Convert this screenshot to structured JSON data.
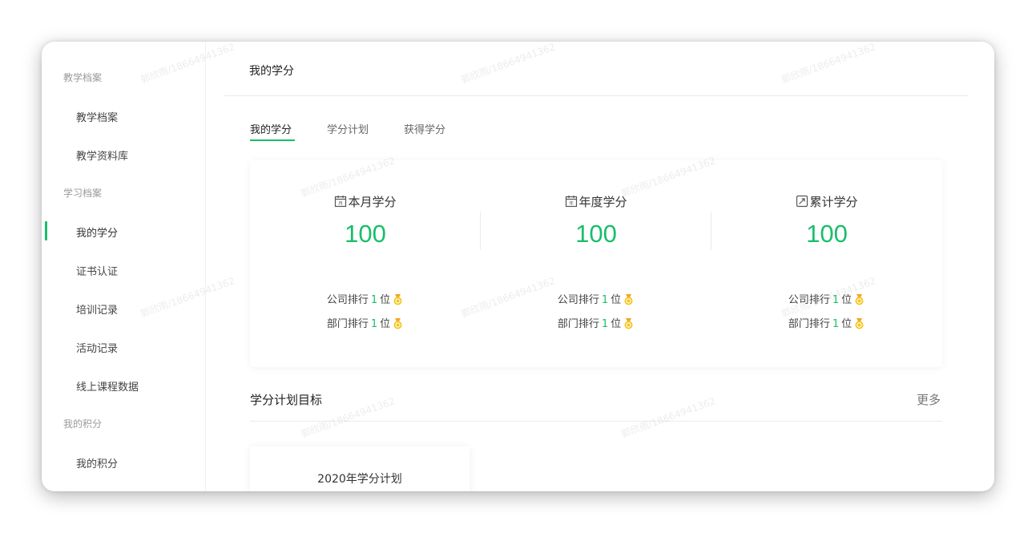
{
  "sidebar": {
    "groups": [
      {
        "label": "教学档案",
        "items": [
          "教学档案",
          "教学资料库"
        ]
      },
      {
        "label": "学习档案",
        "items": [
          "我的学分",
          "证书认证",
          "培训记录",
          "活动记录",
          "线上课程数据"
        ]
      },
      {
        "label": "我的积分",
        "items": [
          "我的积分"
        ]
      }
    ],
    "active_item": "我的学分"
  },
  "header": {
    "title": "我的学分"
  },
  "tabs": [
    {
      "label": "我的学分",
      "active": true
    },
    {
      "label": "学分计划",
      "active": false
    },
    {
      "label": "获得学分",
      "active": false
    }
  ],
  "stats": [
    {
      "label": "本月学分",
      "icon": "calendar-month-icon",
      "value": "100",
      "company_rank_label": "公司排行",
      "company_rank": "1",
      "dept_rank_label": "部门排行",
      "dept_rank": "1",
      "rank_unit": "位"
    },
    {
      "label": "年度学分",
      "icon": "calendar-year-icon",
      "value": "100",
      "company_rank_label": "公司排行",
      "company_rank": "1",
      "dept_rank_label": "部门排行",
      "dept_rank": "1",
      "rank_unit": "位"
    },
    {
      "label": "累计学分",
      "icon": "cumulative-icon",
      "value": "100",
      "company_rank_label": "公司排行",
      "company_rank": "1",
      "dept_rank_label": "部门排行",
      "dept_rank": "1",
      "rank_unit": "位"
    }
  ],
  "plan_section": {
    "title": "学分计划目标",
    "more": "更多"
  },
  "plans": [
    {
      "title": "2020年学分计划"
    }
  ],
  "watermark_text": "郭欣雨/18664941362",
  "colors": {
    "accent": "#19be6b",
    "medal": "#f5c518"
  }
}
